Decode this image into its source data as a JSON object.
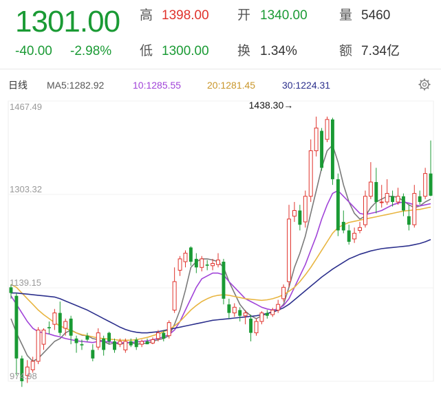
{
  "quote": {
    "price": "1301.00",
    "change": "-40.00",
    "change_pct": "-2.98%",
    "high_label": "高",
    "high": "1398.00",
    "low_label": "低",
    "low": "1300.00",
    "open_label": "开",
    "open": "1340.00",
    "turnover_label": "换",
    "turnover": "1.34%",
    "volume_label": "量",
    "volume": "5460",
    "amount_label": "额",
    "amount": "7.34亿"
  },
  "ma_bar": {
    "period": "日线",
    "ma5": "MA5:1282.92",
    "ma10": "10:1285.55",
    "ma20": "20:1281.45",
    "ma30": "30:1224.31",
    "settings_icon": "gear-icon"
  },
  "colors": {
    "up": "#e0322b",
    "down": "#1a9a34",
    "ma5": "#7a7a7a",
    "ma10": "#a043d8",
    "ma20": "#e8b540",
    "ma30": "#2b2f8c"
  },
  "chart_data": {
    "type": "candlestick",
    "y_ticks": [
      "1467.49",
      "1303.32",
      "1139.15",
      "974.98"
    ],
    "ylim": [
      974.98,
      1467.49
    ],
    "annotation": "1438.30→",
    "candles": [
      [
        1140,
        1130,
        1145,
        1120
      ],
      [
        1125,
        1015,
        1130,
        985
      ],
      [
        1015,
        975,
        1020,
        965
      ],
      [
        985,
        1000,
        1012,
        972
      ],
      [
        995,
        1010,
        1018,
        990
      ],
      [
        1010,
        1065,
        1070,
        1005
      ],
      [
        1040,
        1065,
        1068,
        1030
      ],
      [
        1070,
        1068,
        1080,
        1058
      ],
      [
        1075,
        1095,
        1102,
        1065
      ],
      [
        1095,
        1060,
        1115,
        1055
      ],
      [
        1068,
        1080,
        1085,
        1055
      ],
      [
        1085,
        1055,
        1090,
        1040
      ],
      [
        1050,
        1042,
        1055,
        1025
      ],
      [
        1040,
        1038,
        1048,
        1030
      ],
      [
        1055,
        1048,
        1060,
        1045
      ],
      [
        1030,
        1015,
        1040,
        1010
      ],
      [
        1035,
        1060,
        1068,
        1030
      ],
      [
        1050,
        1030,
        1055,
        1020
      ],
      [
        1060,
        1045,
        1062,
        1040
      ],
      [
        1045,
        1030,
        1050,
        1025
      ],
      [
        1040,
        1045,
        1050,
        1035
      ],
      [
        1030,
        1045,
        1050,
        1025
      ],
      [
        1045,
        1038,
        1050,
        1035
      ],
      [
        1048,
        1035,
        1052,
        1030
      ],
      [
        1040,
        1045,
        1048,
        1035
      ],
      [
        1045,
        1040,
        1050,
        1040
      ],
      [
        1042,
        1048,
        1052,
        1040
      ],
      [
        1050,
        1060,
        1065,
        1045
      ],
      [
        1060,
        1050,
        1065,
        1045
      ],
      [
        1055,
        1078,
        1082,
        1050
      ],
      [
        1100,
        1150,
        1175,
        1095
      ],
      [
        1170,
        1190,
        1195,
        1160
      ],
      [
        1185,
        1200,
        1205,
        1175
      ],
      [
        1210,
        1185,
        1212,
        1178
      ],
      [
        1190,
        1175,
        1200,
        1165
      ],
      [
        1175,
        1190,
        1195,
        1168
      ],
      [
        1180,
        1178,
        1188,
        1170
      ],
      [
        1178,
        1182,
        1190,
        1170
      ],
      [
        1180,
        1188,
        1200,
        1175
      ],
      [
        1185,
        1120,
        1190,
        1110
      ],
      [
        1110,
        1095,
        1120,
        1085
      ],
      [
        1095,
        1105,
        1112,
        1088
      ],
      [
        1100,
        1090,
        1105,
        1080
      ],
      [
        1090,
        1095,
        1100,
        1075
      ],
      [
        1085,
        1060,
        1092,
        1045
      ],
      [
        1060,
        1080,
        1085,
        1055
      ],
      [
        1080,
        1095,
        1098,
        1075
      ],
      [
        1095,
        1090,
        1100,
        1085
      ],
      [
        1092,
        1100,
        1104,
        1088
      ],
      [
        1100,
        1110,
        1118,
        1095
      ],
      [
        1120,
        1140,
        1145,
        1115
      ],
      [
        1150,
        1260,
        1285,
        1140
      ],
      [
        1265,
        1275,
        1290,
        1255
      ],
      [
        1275,
        1250,
        1285,
        1240
      ],
      [
        1255,
        1300,
        1310,
        1245
      ],
      [
        1300,
        1380,
        1400,
        1290
      ],
      [
        1380,
        1420,
        1440,
        1370
      ],
      [
        1415,
        1350,
        1420,
        1345
      ],
      [
        1400,
        1435,
        1440,
        1395
      ],
      [
        1435,
        1330,
        1438,
        1320
      ],
      [
        1330,
        1240,
        1340,
        1230
      ],
      [
        1255,
        1240,
        1275,
        1235
      ],
      [
        1240,
        1220,
        1250,
        1215
      ],
      [
        1225,
        1235,
        1245,
        1218
      ],
      [
        1240,
        1245,
        1255,
        1235
      ],
      [
        1250,
        1300,
        1310,
        1245
      ],
      [
        1300,
        1325,
        1360,
        1295
      ],
      [
        1325,
        1290,
        1350,
        1270
      ],
      [
        1290,
        1290,
        1320,
        1280
      ],
      [
        1290,
        1305,
        1330,
        1285
      ],
      [
        1300,
        1290,
        1310,
        1282
      ],
      [
        1290,
        1300,
        1315,
        1285
      ],
      [
        1300,
        1275,
        1305,
        1265
      ],
      [
        1265,
        1250,
        1285,
        1240
      ],
      [
        1250,
        1305,
        1320,
        1245
      ],
      [
        1300,
        1290,
        1310,
        1285
      ],
      [
        1300,
        1340,
        1350,
        1295
      ],
      [
        1340,
        1301,
        1398,
        1300
      ]
    ],
    "series": [
      {
        "values": [
          1085,
          1060,
          1040,
          1020,
          1010,
          1015,
          1025,
          1035,
          1045,
          1050,
          1060,
          1065,
          1060,
          1056,
          1055,
          1050,
          1048,
          1045,
          1040,
          1042,
          1040,
          1042,
          1043,
          1040,
          1041,
          1042,
          1045,
          1048,
          1050,
          1055,
          1075,
          1100,
          1135,
          1175,
          1185,
          1190,
          1190,
          1188,
          1185,
          1175,
          1150,
          1130,
          1110,
          1098,
          1090,
          1085,
          1090,
          1094,
          1096,
          1100,
          1110,
          1140,
          1175,
          1200,
          1230,
          1270,
          1310,
          1350,
          1380,
          1390,
          1360,
          1320,
          1290,
          1270,
          1260,
          1265,
          1280,
          1290,
          1295,
          1300,
          1300,
          1298,
          1292,
          1285,
          1280,
          1283,
          1290,
          1295
        ]
      },
      {
        "values": [
          1125,
          1110,
          1095,
          1080,
          1068,
          1062,
          1060,
          1058,
          1055,
          1053,
          1050,
          1048,
          1046,
          1045,
          1044,
          1043,
          1045,
          1045,
          1044,
          1043,
          1042,
          1043,
          1043,
          1044,
          1045,
          1046,
          1048,
          1050,
          1053,
          1057,
          1065,
          1080,
          1100,
          1120,
          1140,
          1155,
          1160,
          1165,
          1165,
          1162,
          1150,
          1140,
          1130,
          1120,
          1115,
          1110,
          1105,
          1102,
          1100,
          1102,
          1108,
          1120,
          1140,
          1160,
          1180,
          1205,
          1230,
          1260,
          1285,
          1305,
          1310,
          1300,
          1290,
          1280,
          1270,
          1268,
          1270,
          1272,
          1275,
          1280,
          1285,
          1288,
          1290,
          1288,
          1285,
          1283,
          1285,
          1287
        ]
      },
      {
        "values": [
          1145,
          1140,
          1130,
          1120,
          1110,
          1100,
          1092,
          1085,
          1078,
          1072,
          1068,
          1064,
          1060,
          1057,
          1055,
          1053,
          1051,
          1050,
          1049,
          1048,
          1047,
          1047,
          1047,
          1048,
          1050,
          1052,
          1055,
          1058,
          1062,
          1066,
          1072,
          1080,
          1090,
          1100,
          1108,
          1115,
          1120,
          1124,
          1126,
          1127,
          1126,
          1124,
          1122,
          1120,
          1119,
          1118,
          1117,
          1118,
          1120,
          1123,
          1127,
          1133,
          1140,
          1150,
          1162,
          1175,
          1190,
          1205,
          1220,
          1235,
          1245,
          1250,
          1254,
          1256,
          1258,
          1260,
          1262,
          1264,
          1266,
          1268,
          1270,
          1272,
          1274,
          1275,
          1276,
          1277,
          1279,
          1281
        ]
      },
      {
        "values": [
          1130,
          1130,
          1129,
          1128,
          1127,
          1126,
          1125,
          1124,
          1123,
          1120,
          1116,
          1112,
          1108,
          1104,
          1100,
          1095,
          1090,
          1085,
          1080,
          1075,
          1070,
          1066,
          1063,
          1061,
          1060,
          1060,
          1061,
          1062,
          1064,
          1066,
          1068,
          1070,
          1072,
          1074,
          1076,
          1078,
          1080,
          1082,
          1083,
          1084,
          1085,
          1086,
          1087,
          1088,
          1089,
          1090,
          1092,
          1094,
          1097,
          1100,
          1104,
          1110,
          1118,
          1126,
          1134,
          1142,
          1150,
          1158,
          1165,
          1172,
          1178,
          1184,
          1190,
          1194,
          1198,
          1201,
          1204,
          1206,
          1208,
          1209,
          1210,
          1211,
          1212,
          1213,
          1215,
          1217,
          1220,
          1224
        ]
      }
    ]
  }
}
